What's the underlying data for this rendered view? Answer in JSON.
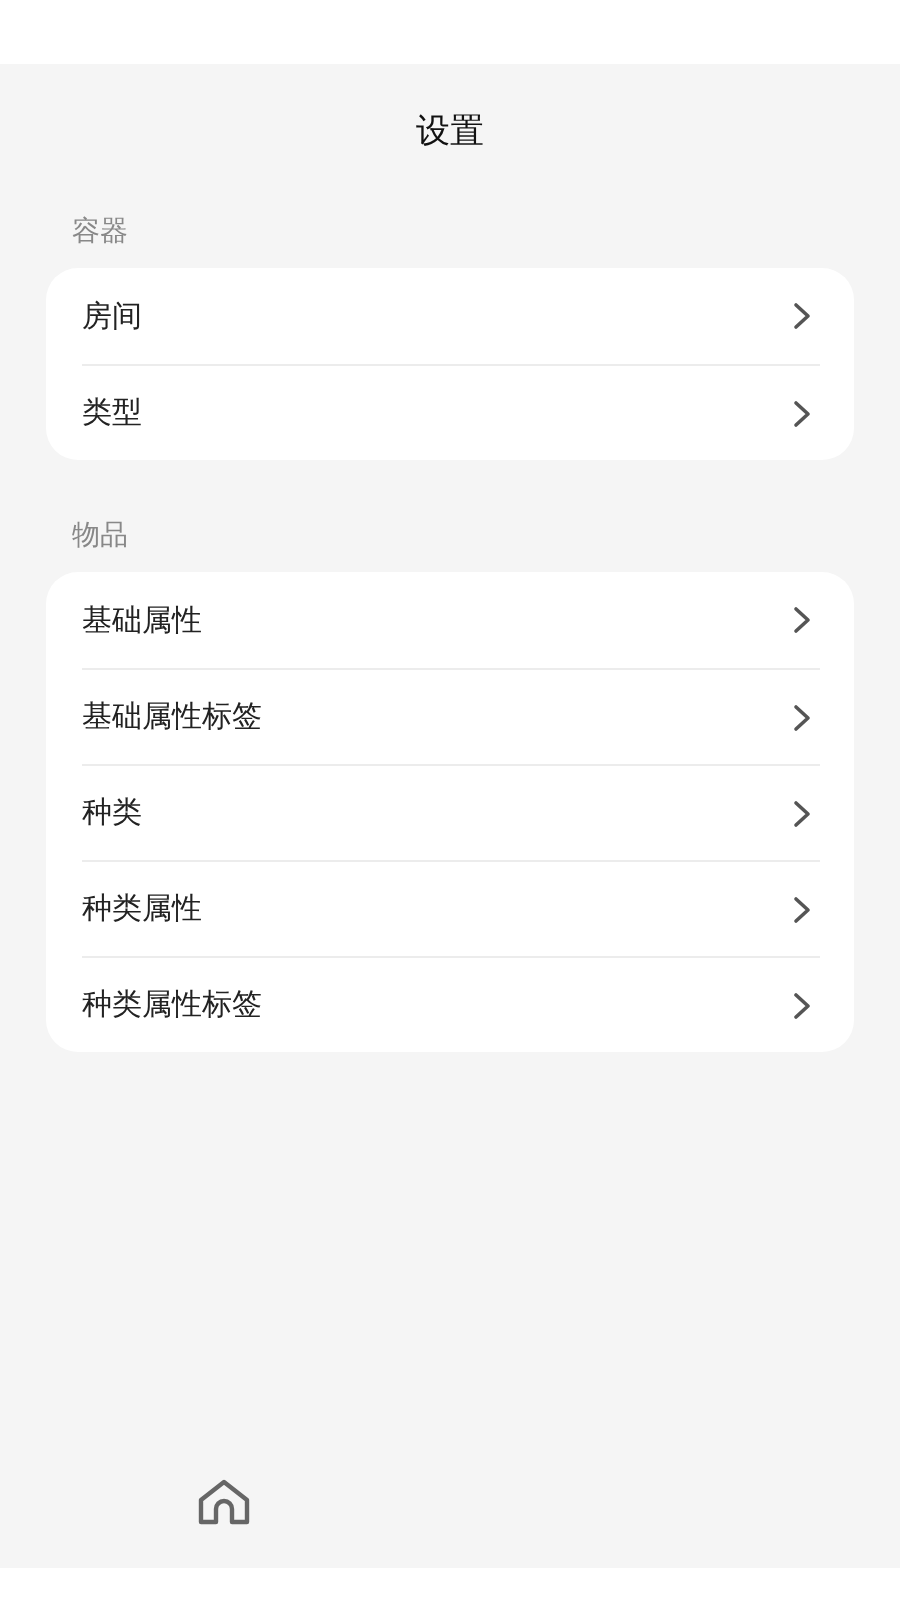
{
  "title": "设置",
  "sections": [
    {
      "label": "容器",
      "items": [
        "房间",
        "类型"
      ]
    },
    {
      "label": "物品",
      "items": [
        "基础属性",
        "基础属性标签",
        "种类",
        "种类属性",
        "种类属性标签"
      ]
    }
  ]
}
